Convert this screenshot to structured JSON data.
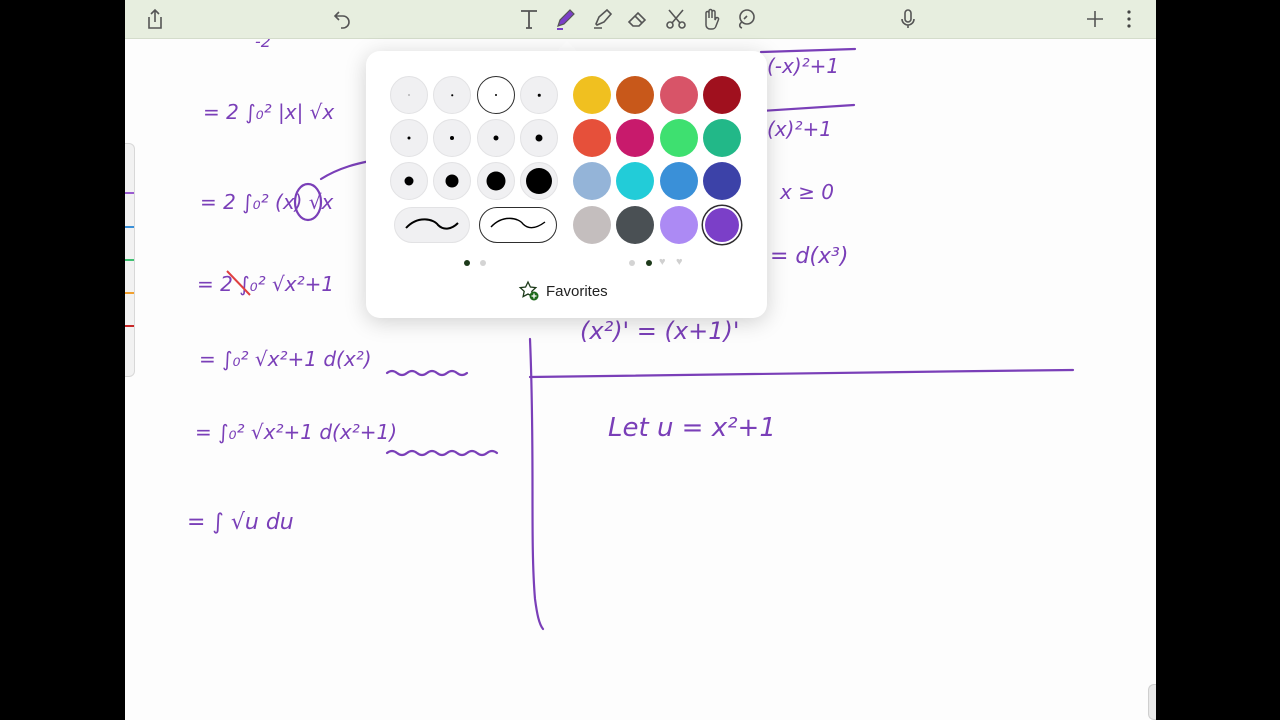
{
  "toolbar": {
    "icons": [
      "share-icon",
      "undo-icon",
      "text-tool-icon",
      "pen-tool-icon",
      "highlighter-tool-icon",
      "eraser-tool-icon",
      "scissors-icon",
      "hand-tool-icon",
      "lasso-icon",
      "microphone-icon",
      "plus-icon",
      "more-icon"
    ],
    "active_tool": "pen"
  },
  "popover": {
    "favorites_label": "Favorites",
    "selected_color": "#7b3fc8",
    "colors": [
      "#f0c020",
      "#c8581a",
      "#d85468",
      "#a0101e",
      "#e6503a",
      "#c81a6c",
      "#3ee070",
      "#22b888",
      "#94b4d8",
      "#22ccd8",
      "#3a90d8",
      "#3c42a8",
      "#c4bebe",
      "#4a5054",
      "#ac8af4",
      "#7b3fc8"
    ]
  },
  "notes": {
    "ink_color": "#7a3fb8",
    "top_fragment": "-2",
    "left_column": [
      "= 2 ∫₀² |x| √x",
      "= 2 ∫₀² (x) √x",
      "= 2 ∫₀² √x²+1",
      "= ∫₀² √x²+1  d(x²)",
      "= ∫₀² √x²+1  d(x²+1)",
      "= ∫  √u  du"
    ],
    "right_column": [
      "(-x)²+1",
      "(x)²+1",
      "x ≥ 0",
      "= d(x³)",
      "(x²)' = (x+1)'",
      "Let  u = x²+1"
    ]
  }
}
